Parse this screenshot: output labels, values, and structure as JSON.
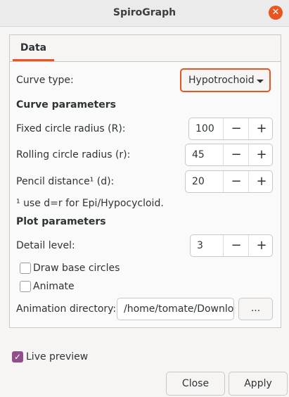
{
  "window": {
    "title": "SpiroGraph",
    "close_glyph": "✕"
  },
  "tabs": [
    {
      "label": "Data",
      "selected": true
    }
  ],
  "curve_type": {
    "label": "Curve type:",
    "value": "Hypotrochoid"
  },
  "curve_parameters": {
    "heading": "Curve parameters",
    "fixed_radius": {
      "label": "Fixed circle radius (R):",
      "value": "100"
    },
    "rolling_radius": {
      "label": "Rolling circle radius (r):",
      "value": "45"
    },
    "pencil_distance": {
      "label": "Pencil distance¹ (d):",
      "value": "20"
    },
    "footnote": "¹ use d=r for Epi/Hypocycloid."
  },
  "plot_parameters": {
    "heading": "Plot parameters",
    "detail_level": {
      "label": "Detail level:",
      "value": "3"
    },
    "draw_base_circles": {
      "label": "Draw base circles",
      "checked": false
    },
    "animate": {
      "label": "Animate",
      "checked": false
    },
    "animation_directory": {
      "label": "Animation directory:",
      "value": "/home/tomate/Downloads",
      "browse_label": "..."
    }
  },
  "spin_glyphs": {
    "minus": "−",
    "plus": "+"
  },
  "live_preview": {
    "label": "Live preview",
    "checked": true,
    "check_glyph": "✓"
  },
  "buttons": {
    "close": "Close",
    "apply": "Apply"
  },
  "colors": {
    "accent": "#e95420",
    "check": "#924d8b"
  }
}
